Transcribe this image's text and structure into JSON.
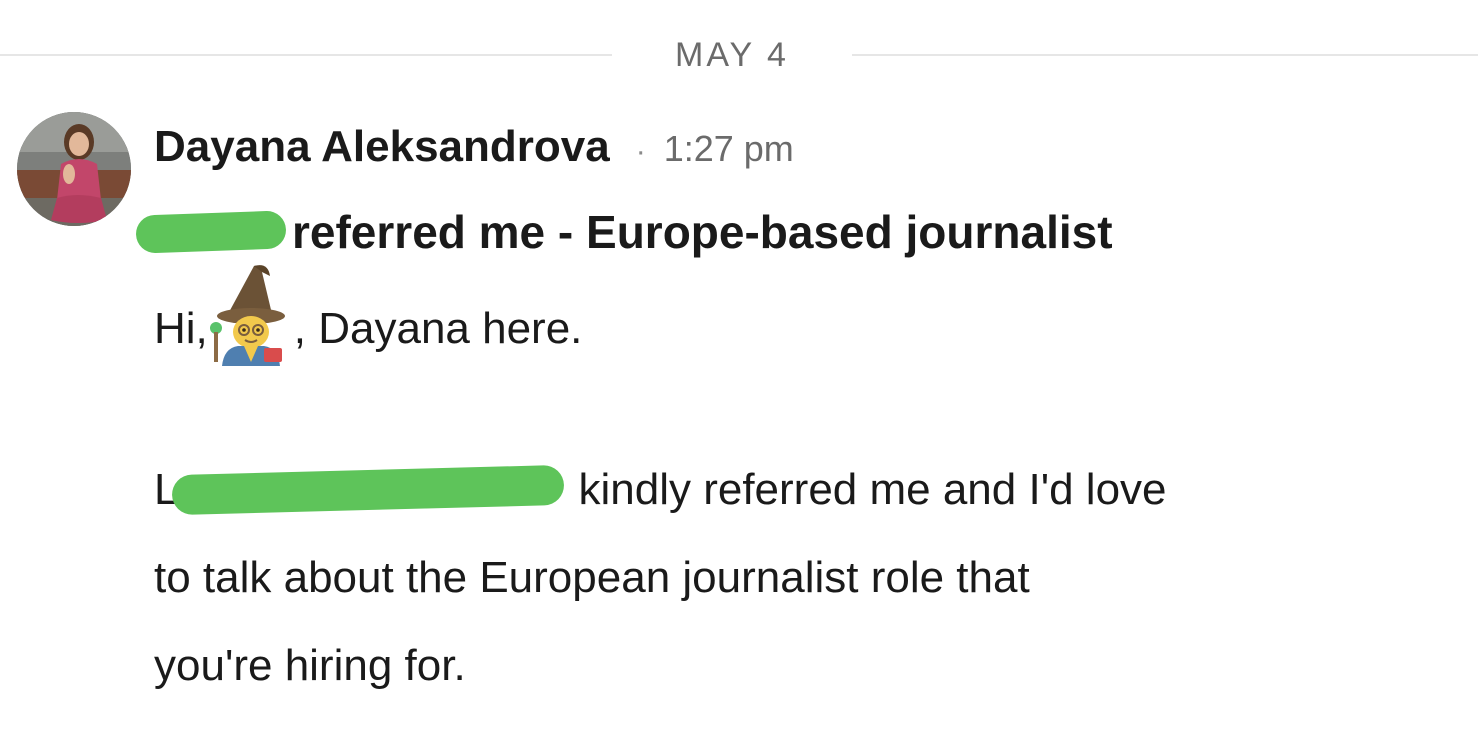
{
  "conversation": {
    "date_label": "MAY 4"
  },
  "message": {
    "sender_name": "Dayana Aleksandrova",
    "separator": "·",
    "time": "1:27 pm",
    "subject_visible": "referred me - Europe-based journalist",
    "greeting_prefix": "Hi,",
    "greeting_suffix": ", Dayana here.",
    "para2_line1_start": "L",
    "para2_line1_rest": "kindly referred me and I'd love",
    "para2_line2": "to talk about the European journalist role that",
    "para2_line3": "you're hiring for."
  },
  "icons": {
    "avatar": "profile-photo",
    "emoji": "mage-emoji"
  },
  "colors": {
    "redaction": "#5ec45a",
    "meta_text": "#6b6b6b",
    "divider": "#e6e6e6"
  }
}
